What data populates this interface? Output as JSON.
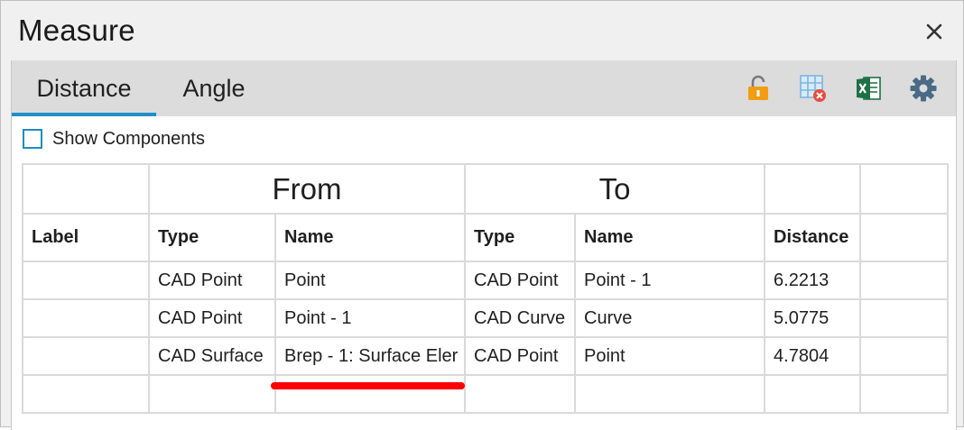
{
  "window": {
    "title": "Measure"
  },
  "tabs": [
    {
      "label": "Distance",
      "active": true
    },
    {
      "label": "Angle",
      "active": false
    }
  ],
  "toolbar": {
    "icons": [
      "unlock-icon",
      "clear-table-icon",
      "excel-export-icon",
      "settings-gear-icon"
    ]
  },
  "options": {
    "show_components_label": "Show Components",
    "show_components_checked": false
  },
  "table": {
    "group_headers": {
      "from": "From",
      "to": "To"
    },
    "columns": [
      "Label",
      "Type",
      "Name",
      "Type",
      "Name",
      "Distance",
      ""
    ],
    "rows": [
      {
        "label": "",
        "from_type": "CAD Point",
        "from_name": "Point",
        "to_type": "CAD Point",
        "to_name": "Point - 1",
        "distance": "6.2213"
      },
      {
        "label": "",
        "from_type": "CAD Point",
        "from_name": "Point - 1",
        "to_type": "CAD Curve",
        "to_name": "Curve",
        "distance": "5.0775"
      },
      {
        "label": "",
        "from_type": "CAD Surface",
        "from_name": "Brep - 1: Surface Eler",
        "to_type": "CAD Point",
        "to_name": "Point",
        "distance": "4.7804"
      }
    ]
  },
  "colors": {
    "accent": "#1e90c8",
    "annotation": "#ff0000",
    "lock": "#f39c12",
    "excel": "#1e7145"
  }
}
